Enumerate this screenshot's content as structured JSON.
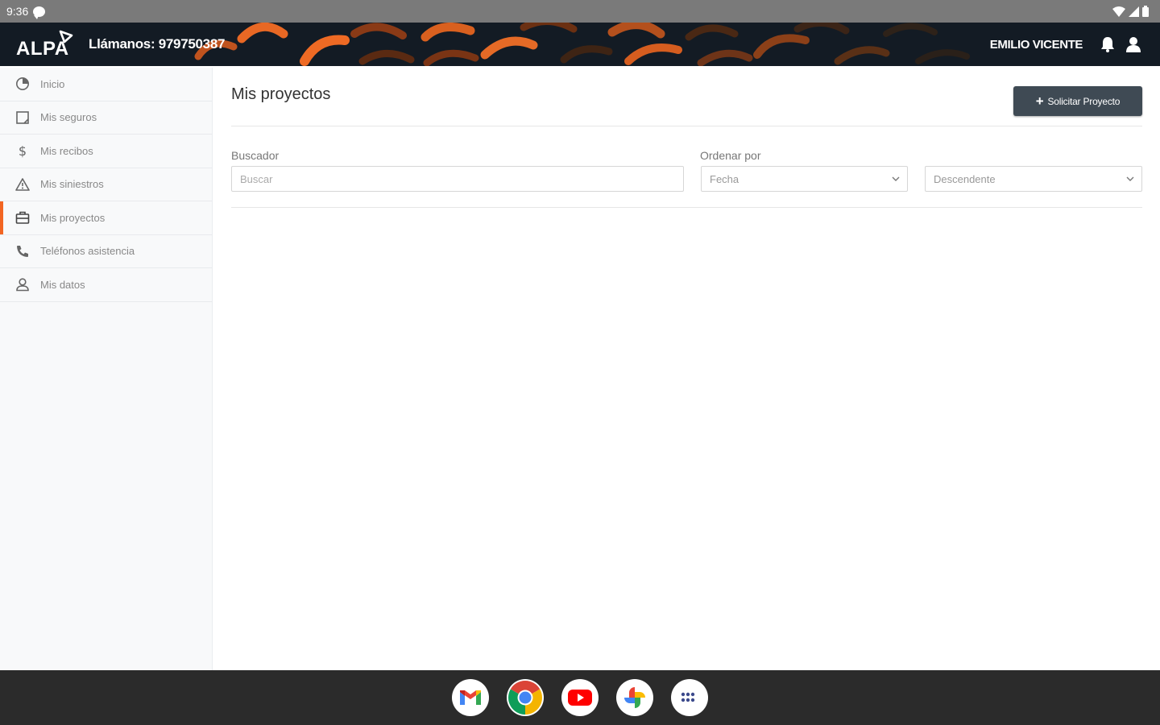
{
  "status_bar": {
    "time": "9:36"
  },
  "header": {
    "logo_text": "ALPA",
    "call_text": "Llámanos: 979750387",
    "user_name": "EMILIO VICENTE"
  },
  "sidebar": {
    "items": [
      {
        "label": "Inicio",
        "icon": "dashboard-icon"
      },
      {
        "label": "Mis seguros",
        "icon": "document-icon"
      },
      {
        "label": "Mis recibos",
        "icon": "dollar-icon"
      },
      {
        "label": "Mis siniestros",
        "icon": "warning-icon"
      },
      {
        "label": "Mis proyectos",
        "icon": "briefcase-icon",
        "active": true
      },
      {
        "label": "Teléfonos asistencia",
        "icon": "phone-icon"
      },
      {
        "label": "Mis datos",
        "icon": "user-icon"
      }
    ]
  },
  "main": {
    "title": "Mis proyectos",
    "request_button": "Solicitar Proyecto",
    "search": {
      "label": "Buscador",
      "placeholder": "Buscar",
      "value": ""
    },
    "sort": {
      "label": "Ordenar por",
      "field_value": "Fecha",
      "direction_value": "Descendente"
    }
  },
  "taskbar": {
    "apps": [
      "gmail-icon",
      "chrome-icon",
      "youtube-icon",
      "photos-icon",
      "app-launcher-icon"
    ]
  },
  "colors": {
    "accent": "#f26522",
    "header_bg": "#131b24",
    "button_bg": "#3f4a54",
    "sidebar_bg": "#f8f9fa",
    "taskbar_bg": "#2b2b2b"
  }
}
